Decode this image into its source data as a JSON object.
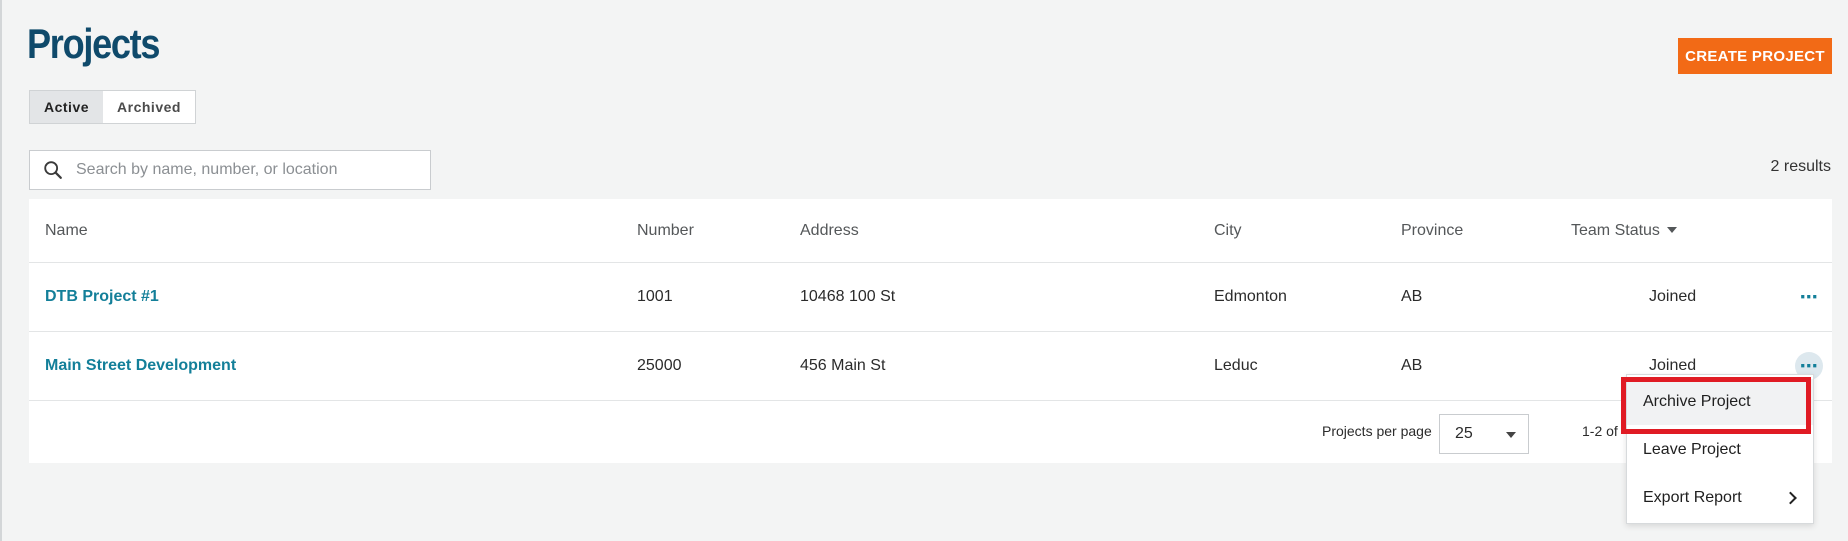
{
  "page": {
    "title": "Projects",
    "create_button_label": "CREATE PROJECT"
  },
  "tabs": [
    {
      "label": "Active",
      "selected": true
    },
    {
      "label": "Archived",
      "selected": false
    }
  ],
  "search": {
    "placeholder": "Search by name, number, or location",
    "value": ""
  },
  "results_label": "2 results",
  "table": {
    "columns": [
      "Name",
      "Number",
      "Address",
      "City",
      "Province",
      "Team Status"
    ],
    "sorted_column": "Team Status",
    "rows": [
      {
        "name": "DTB Project #1",
        "number": "1001",
        "address": "10468 100 St",
        "city": "Edmonton",
        "province": "AB",
        "team_status": "Joined",
        "more": "⋯"
      },
      {
        "name": "Main Street Development",
        "number": "25000",
        "address": "456 Main St",
        "city": "Leduc",
        "province": "AB",
        "team_status": "Joined",
        "more": "⋯"
      }
    ]
  },
  "pagination": {
    "per_page_label": "Projects per page",
    "per_page_value": "25",
    "range_label": "1-2 of"
  },
  "context_menu": {
    "items": [
      {
        "label": "Archive Project",
        "highlighted": true
      },
      {
        "label": "Leave Project"
      },
      {
        "label": "Export Report",
        "has_submenu": true
      }
    ]
  },
  "colors": {
    "brand_title": "#0f4a6b",
    "accent_orange": "#f26a16",
    "link_teal": "#137f99",
    "highlight_red": "#e01b24",
    "background": "#f3f4f4"
  },
  "icons": [
    "search-icon",
    "more-horizontal-icon",
    "chevron-down-icon",
    "chevron-right-icon",
    "sort-caret-icon"
  ]
}
